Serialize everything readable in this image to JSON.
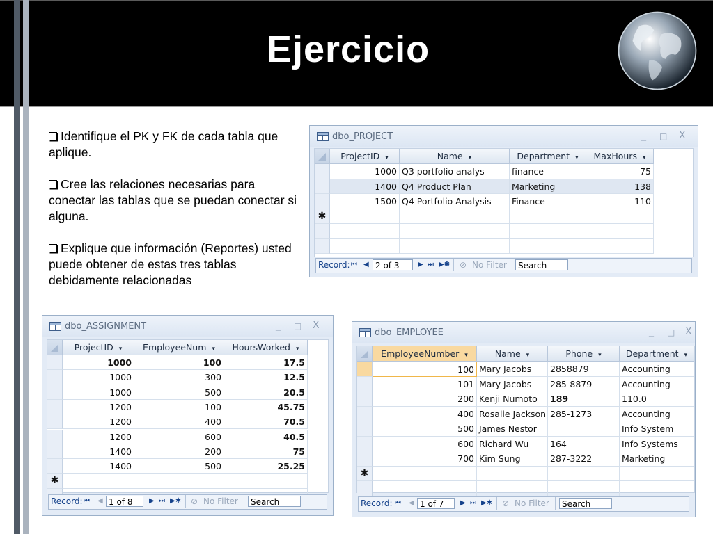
{
  "slide": {
    "title": "Ejercicio",
    "bullets": [
      "Identifique el PK y FK de cada tabla que aplique.",
      "Cree las relaciones necesarias para conectar las tablas que se puedan conectar si alguna.",
      "Explique que información (Reportes) usted puede obtener de estas tres tablas debidamente relacionadas"
    ]
  },
  "window_controls": {
    "minimize": "_",
    "maximize": "□",
    "close": "X"
  },
  "nav_labels": {
    "record": "Record:",
    "no_filter": "No Filter",
    "search": "Search",
    "first": "⏮",
    "prev": "◀",
    "next": "▶",
    "last": "⏭",
    "new": "▶✱"
  },
  "project": {
    "title": "dbo_PROJECT",
    "columns": [
      "ProjectID",
      "Name",
      "Department",
      "MaxHours"
    ],
    "rows": [
      [
        "1000",
        "Q3 portfolio analys",
        "finance",
        "75"
      ],
      [
        "1400",
        "Q4 Product Plan",
        "Marketing",
        "138"
      ],
      [
        "1500",
        "Q4 Portfolio Analysis",
        "Finance",
        "110"
      ]
    ],
    "record": "2 of 3",
    "selected_row": 1
  },
  "assignment": {
    "title": "dbo_ASSIGNMENT",
    "columns": [
      "ProjectID",
      "EmployeeNum",
      "HoursWorked"
    ],
    "rows": [
      [
        "1000",
        "100",
        "17.5"
      ],
      [
        "1000",
        "300",
        "12.5"
      ],
      [
        "1000",
        "500",
        "20.5"
      ],
      [
        "1200",
        "100",
        "45.75"
      ],
      [
        "1200",
        "400",
        "70.5"
      ],
      [
        "1200",
        "600",
        "40.5"
      ],
      [
        "1400",
        "200",
        "75"
      ],
      [
        "1400",
        "500",
        "25.25"
      ]
    ],
    "record": "1 of 8",
    "selected_row": 0
  },
  "employee": {
    "title": "dbo_EMPLOYEE",
    "columns": [
      "EmployeeNumber",
      "Name",
      "Phone",
      "Department"
    ],
    "rows": [
      [
        "100",
        "Mary Jacobs",
        "2858879",
        "Accounting"
      ],
      [
        "101",
        "Mary Jacobs",
        "285-8879",
        "Accounting"
      ],
      [
        "200",
        "Kenji Numoto",
        "189",
        "110.0"
      ],
      [
        "400",
        "Rosalie Jackson",
        "285-1273",
        "Accounting"
      ],
      [
        "500",
        "James Nestor",
        "",
        "Info System"
      ],
      [
        "600",
        "Richard Wu",
        "164",
        "Info Systems"
      ],
      [
        "700",
        "Kim Sung",
        "287-3222",
        "Marketing"
      ]
    ],
    "record": "1 of 7",
    "selected_row": 0
  }
}
